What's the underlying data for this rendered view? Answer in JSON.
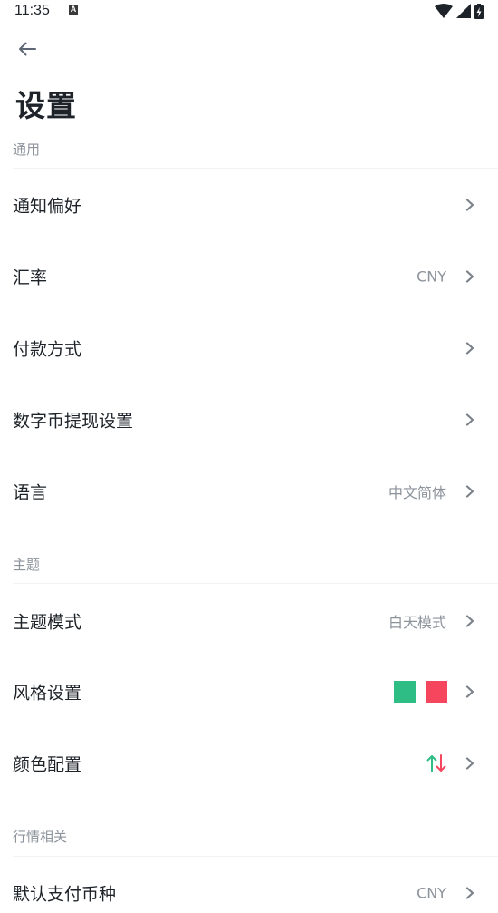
{
  "status_bar": {
    "time": "11:35",
    "notification_letter": "A",
    "icons": [
      "wifi-icon",
      "signal-icon",
      "battery-charging-icon"
    ]
  },
  "header": {
    "back_icon": "arrow-left-icon",
    "title": "设置"
  },
  "sections": {
    "general": {
      "label": "通用",
      "items": [
        {
          "label": "通知偏好",
          "value": ""
        },
        {
          "label": "汇率",
          "value": "CNY"
        },
        {
          "label": "付款方式",
          "value": ""
        },
        {
          "label": "数字币提现设置",
          "value": ""
        },
        {
          "label": "语言",
          "value": "中文简体"
        }
      ]
    },
    "theme": {
      "label": "主题",
      "items": [
        {
          "label": "主题模式",
          "value": "白天模式"
        },
        {
          "label": "风格设置",
          "swatches": [
            "#2ebd85",
            "#f6465d"
          ]
        },
        {
          "label": "颜色配置",
          "icon": "arrow-up-down-icon",
          "up_color": "#2ebd85",
          "down_color": "#f6465d"
        }
      ]
    },
    "market": {
      "label": "行情相关",
      "items": [
        {
          "label": "默认支付币种",
          "value": "CNY"
        }
      ]
    }
  },
  "colors": {
    "text_primary": "#1e2329",
    "text_secondary": "#8c939b",
    "chevron": "#7b828a",
    "up": "#2ebd85",
    "down": "#f6465d"
  }
}
